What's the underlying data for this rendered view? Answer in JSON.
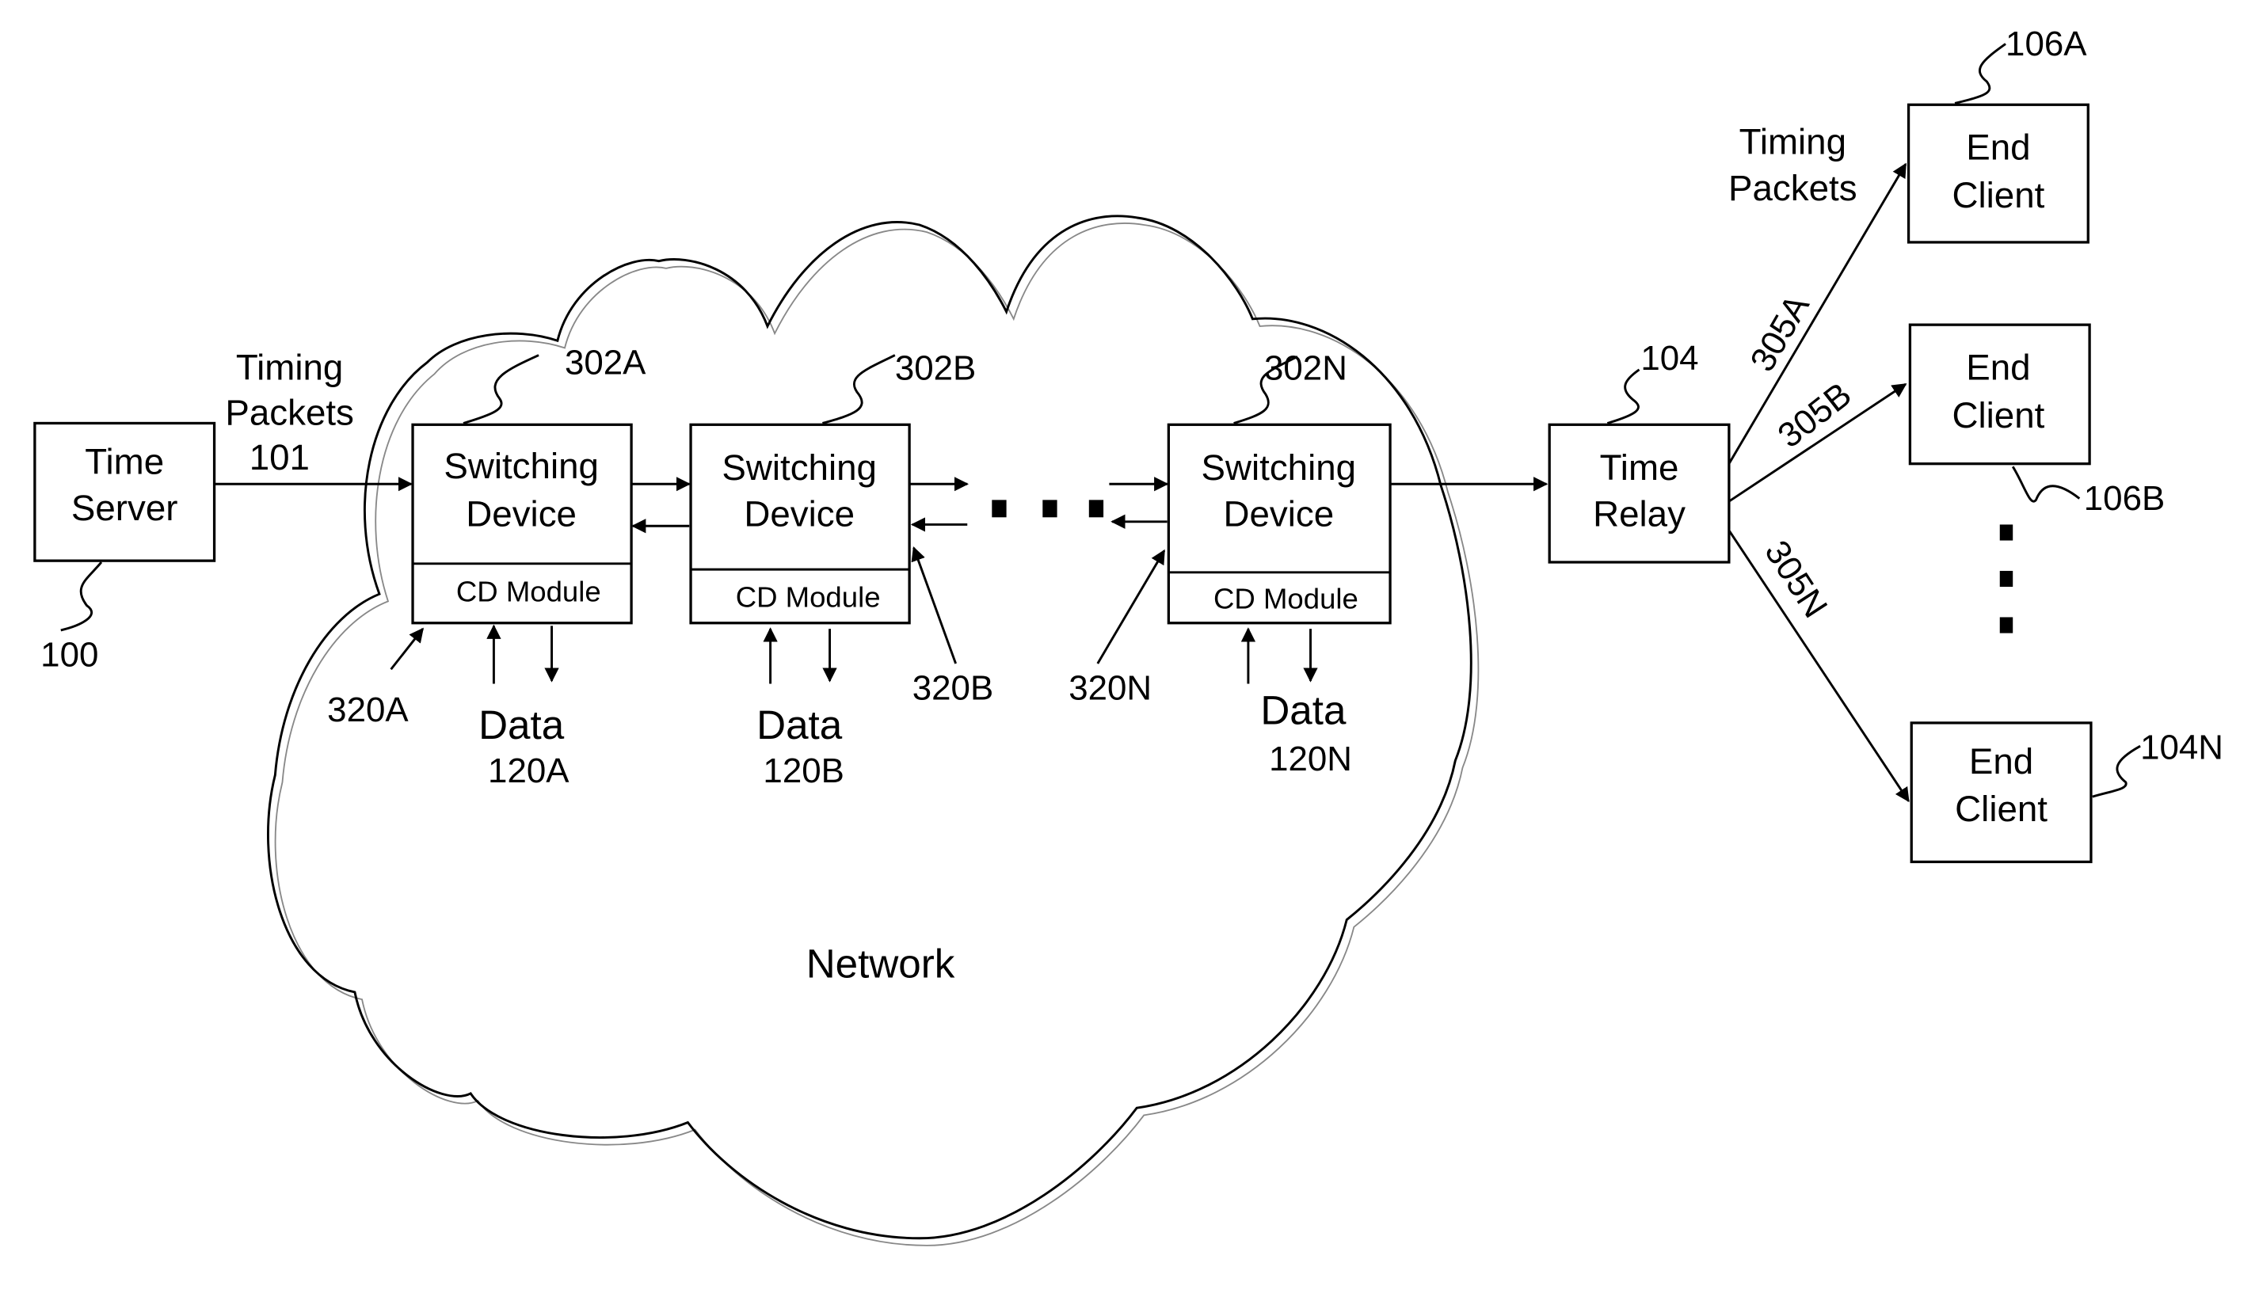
{
  "diagram": {
    "time_server": {
      "line1": "Time",
      "line2": "Server",
      "ref": "100"
    },
    "timing_packets_in": {
      "line1": "Timing",
      "line2": "Packets",
      "ref": "101"
    },
    "switching_devices": [
      {
        "line1": "Switching",
        "line2": "Device",
        "module": "CD Module",
        "ref": "302A",
        "port_ref": "320A",
        "data_label": "Data",
        "data_ref": "120A"
      },
      {
        "line1": "Switching",
        "line2": "Device",
        "module": "CD Module",
        "ref": "302B",
        "port_ref": "320B",
        "data_label": "Data",
        "data_ref": "120B"
      },
      {
        "line1": "Switching",
        "line2": "Device",
        "module": "CD Module",
        "ref": "302N",
        "port_ref": "320N",
        "data_label": "Data",
        "data_ref": "120N"
      }
    ],
    "network_label": "Network",
    "time_relay": {
      "line1": "Time",
      "line2": "Relay",
      "ref": "104"
    },
    "timing_packets_out": {
      "line1": "Timing",
      "line2": "Packets"
    },
    "links": [
      "305A",
      "305B",
      "305N"
    ],
    "end_clients": [
      {
        "line1": "End",
        "line2": "Client",
        "ref": "106A"
      },
      {
        "line1": "End",
        "line2": "Client",
        "ref": "106B"
      },
      {
        "line1": "End",
        "line2": "Client",
        "ref": "104N"
      }
    ]
  }
}
